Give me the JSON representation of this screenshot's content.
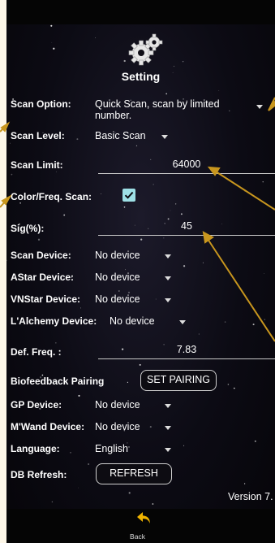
{
  "screen": {
    "title": "Setting"
  },
  "settings": {
    "scan_option": {
      "label": "Scan Option:",
      "value": "Quick Scan, scan by limited number."
    },
    "scan_level": {
      "label": "Scan Level:",
      "value": "Basic Scan"
    },
    "scan_limit": {
      "label": "Scan Limit:",
      "value": "64000"
    },
    "color_freq_scan": {
      "label": "Color/Freq. Scan:",
      "checked": true
    },
    "sig": {
      "label": "Sig(%):",
      "value": "45"
    },
    "scan_device": {
      "label": "Scan Device:",
      "value": "No device"
    },
    "astar_device": {
      "label": "AStar Device:",
      "value": "No device"
    },
    "vnstar_device": {
      "label": "VNStar Device:",
      "value": "No device"
    },
    "lalchemy_device": {
      "label": "L'Alchemy Device:",
      "value": "No device"
    },
    "def_freq": {
      "label": "Def. Freq. :",
      "value": "7.83"
    },
    "biofeedback": {
      "label": "Biofeedback Pairing",
      "button": "SET PAIRING"
    },
    "gp_device": {
      "label": "GP Device:",
      "value": "No device"
    },
    "mwand_device": {
      "label": "M'Wand Device:",
      "value": "No device"
    },
    "language": {
      "label": "Language:",
      "value": "English"
    },
    "db_refresh": {
      "label": "DB Refresh:",
      "button": "REFRESH"
    }
  },
  "footer": {
    "version": "Version 7.",
    "back_label": "Back"
  },
  "colors": {
    "accent_checkbox": "#9ee0e6",
    "annotation_arrow": "#c8961e",
    "back_icon": "#f0b400"
  },
  "icons": [
    "gear-icon",
    "back-arrow-icon",
    "checkmark-icon",
    "dropdown-caret-icon"
  ]
}
